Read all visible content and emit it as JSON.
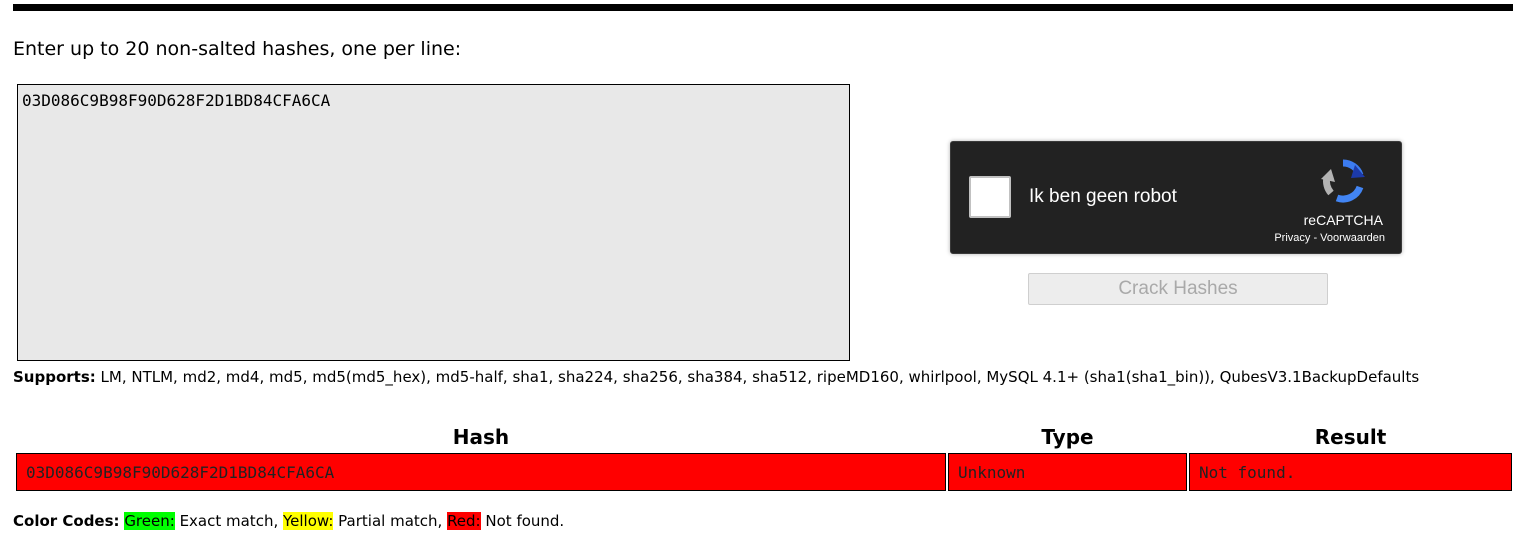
{
  "prompt": "Enter up to 20 non-salted hashes, one per line:",
  "hash_input": {
    "value": "03D086C9B98F90D628F2D1BD84CFA6CA"
  },
  "captcha": {
    "label": "Ik ben geen robot",
    "brand": "reCAPTCHA",
    "privacy": "Privacy",
    "separator": " - ",
    "terms": "Voorwaarden"
  },
  "crack_button": "Crack Hashes",
  "supports": {
    "heading": "Supports:",
    "text": " LM, NTLM, md2, md4, md5, md5(md5_hex), md5-half, sha1, sha224, sha256, sha384, sha512, ripeMD160, whirlpool, MySQL 4.1+ (sha1(sha1_bin)), QubesV3.1BackupDefaults"
  },
  "results": {
    "headers": [
      "Hash",
      "Type",
      "Result"
    ],
    "rows": [
      {
        "hash": "03D086C9B98F90D628F2D1BD84CFA6CA",
        "type": "Unknown",
        "result": "Not found.",
        "status_color": "#ff0000"
      }
    ]
  },
  "color_codes": {
    "heading": "Color Codes:",
    "green_label": "Green:",
    "green_text": " Exact match, ",
    "yellow_label": "Yellow:",
    "yellow_text": " Partial match, ",
    "red_label": "Red:",
    "red_text": " Not found.",
    "colors": {
      "green": "#00ff00",
      "yellow": "#ffff00",
      "red": "#ff0000"
    }
  }
}
